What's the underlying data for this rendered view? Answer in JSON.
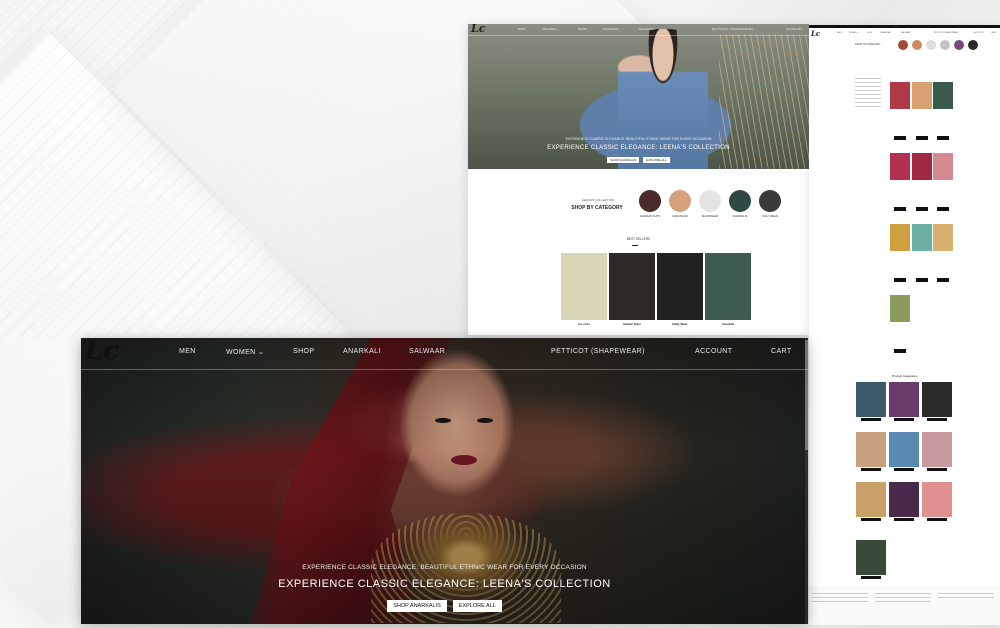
{
  "brand": {
    "logo": "Lc"
  },
  "hero_large": {
    "nav": [
      "MEN",
      "WOMEN ⌄",
      "SHOP",
      "ANARKALI",
      "SALWAAR",
      "PETTICOT (SHAPEWEAR)",
      "ACCOUNT",
      "CART"
    ],
    "tagline": "EXPERIENCE CLASSIC ELEGANCE: BEAUTIFUL ETHNIC WEAR FOR EVERY OCCASION",
    "title": "EXPERIENCE CLASSIC ELEGANCE: LEENA'S COLLECTION",
    "buttons": {
      "primary": "SHOP ANARKALIS",
      "secondary": "EXPLORE ALL"
    }
  },
  "hero_small": {
    "nav": [
      "MEN",
      "WOMEN ⌄",
      "SHOP",
      "ANARKALI",
      "SALWAAR",
      "PETTICOT (SHAPEWEAR)",
      "ACCOUNT"
    ],
    "tagline": "EXPERIENCE CLASSIC ELEGANCE: BEAUTIFUL ETHNIC WEAR FOR EVERY OCCASION",
    "title": "EXPERIENCE CLASSIC ELEGANCE: LEENA'S COLLECTION",
    "buttons": {
      "primary": "SHOP ANARKALIS",
      "secondary": "EXPLORE ALL"
    }
  },
  "categories": {
    "label": "LEENA'S COLLECTION",
    "title": "SHOP BY CATEGORY",
    "items": [
      {
        "name": "SALWAAR SUITS",
        "color": "#4a2a2a"
      },
      {
        "name": "CHIKANKARI",
        "color": "#d6a27e"
      },
      {
        "name": "SHAPEWEAR",
        "color": "#e4e4e4"
      },
      {
        "name": "ANARKALIS",
        "color": "#2f4a44"
      },
      {
        "name": "DAILY WEAR",
        "color": "#3a3a3a"
      }
    ]
  },
  "best_sellers": {
    "title": "BEST SELLERS",
    "tabs": [
      "",
      ""
    ],
    "items": [
      {
        "name": "Co-ords",
        "desc": "",
        "color": "#d8d6b6"
      },
      {
        "name": "Salwar Suits",
        "desc": "",
        "color": "#2d2a28"
      },
      {
        "name": "Daily Wear",
        "desc": "",
        "color": "#222222"
      },
      {
        "name": "Anarkali",
        "desc": "",
        "color": "#3c5a52"
      }
    ]
  },
  "shop_page": {
    "title": "SHOP IN CATEGORY",
    "section": "Product Categories",
    "categories": [
      {
        "name": "",
        "color": "#a24a36"
      },
      {
        "name": "",
        "color": "#d08a5e"
      },
      {
        "name": "",
        "color": "#dddddd"
      },
      {
        "name": "",
        "color": "#c4c4c4"
      },
      {
        "name": "",
        "color": "#7a4a7a"
      },
      {
        "name": "",
        "color": "#2a2a2a"
      }
    ],
    "products": [
      {
        "color": "#b03a4a"
      },
      {
        "color": "#d9a070"
      },
      {
        "color": "#3a5a4a"
      },
      {
        "color": "#b23050"
      },
      {
        "color": "#a02840"
      },
      {
        "color": "#d48a90"
      },
      {
        "color": "#d0a040"
      },
      {
        "color": "#6ab0a0"
      },
      {
        "color": "#d8b070"
      },
      {
        "color": "#8a9a5a"
      }
    ],
    "product_categories": [
      {
        "name": "",
        "color": "#3a5a6a"
      },
      {
        "name": "",
        "color": "#6a3a6a"
      },
      {
        "name": "",
        "color": "#2a2a2a"
      },
      {
        "name": "",
        "color": "#c8a080"
      },
      {
        "name": "",
        "color": "#5a8ab0"
      },
      {
        "name": "",
        "color": "#c89aa0"
      },
      {
        "name": "",
        "color": "#c8a068"
      },
      {
        "name": "",
        "color": "#4a2a4a"
      },
      {
        "name": "",
        "color": "#e09090"
      },
      {
        "name": "",
        "color": "#3a4a3a"
      }
    ]
  }
}
